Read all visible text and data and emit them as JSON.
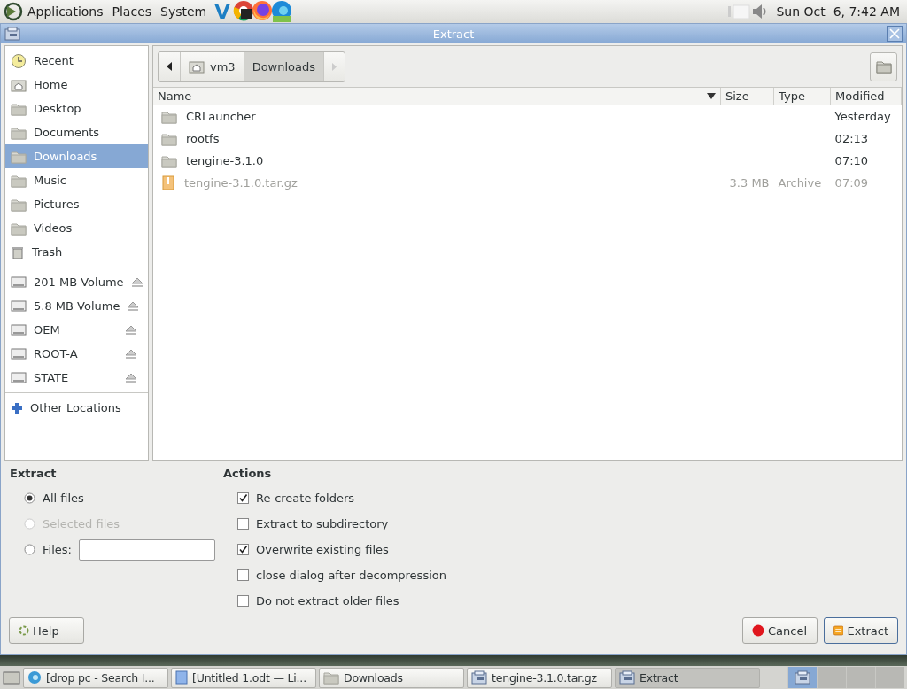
{
  "top_panel": {
    "menus": [
      {
        "label": "Applications"
      },
      {
        "label": "Places"
      },
      {
        "label": "System"
      }
    ],
    "clock": "Sun Oct  6, 7:42 AM"
  },
  "window": {
    "title": "Extract"
  },
  "sidebar": {
    "places": [
      {
        "label": "Recent",
        "kind": "recent",
        "selected": false
      },
      {
        "label": "Home",
        "kind": "home",
        "selected": false
      },
      {
        "label": "Desktop",
        "kind": "folder",
        "selected": false
      },
      {
        "label": "Documents",
        "kind": "folder",
        "selected": false
      },
      {
        "label": "Downloads",
        "kind": "folder",
        "selected": true
      },
      {
        "label": "Music",
        "kind": "folder",
        "selected": false
      },
      {
        "label": "Pictures",
        "kind": "folder",
        "selected": false
      },
      {
        "label": "Videos",
        "kind": "folder",
        "selected": false
      },
      {
        "label": "Trash",
        "kind": "trash",
        "selected": false
      }
    ],
    "volumes": [
      {
        "label": "201 MB Volume"
      },
      {
        "label": "5.8 MB Volume"
      },
      {
        "label": "OEM"
      },
      {
        "label": "ROOT-A"
      },
      {
        "label": "STATE"
      }
    ],
    "other": "Other Locations"
  },
  "path_bar": {
    "segments": [
      {
        "label": "vm3",
        "selected": false
      },
      {
        "label": "Downloads",
        "selected": true
      }
    ]
  },
  "files": {
    "columns": [
      "Name",
      "Size",
      "Type",
      "Modified"
    ],
    "rows": [
      {
        "name": "CRLauncher",
        "kind": "folder",
        "modified": "Yesterday",
        "disabled": false
      },
      {
        "name": "rootfs",
        "kind": "folder",
        "modified": "02:13",
        "disabled": false
      },
      {
        "name": "tengine-3.1.0",
        "kind": "folder",
        "modified": "07:10",
        "disabled": false
      },
      {
        "name": "tengine-3.1.0.tar.gz",
        "kind": "archive",
        "size": "3.3 MB",
        "type": "Archive",
        "modified": "07:09",
        "disabled": true
      }
    ]
  },
  "extract": {
    "title": "Extract",
    "options": [
      {
        "label": "All files",
        "kind": "radio",
        "selected": true,
        "disabled": false
      },
      {
        "label": "Selected files",
        "kind": "radio",
        "selected": false,
        "disabled": true
      },
      {
        "label": "Files:",
        "kind": "field",
        "selected": false,
        "disabled": false
      }
    ]
  },
  "actions": {
    "title": "Actions",
    "options": [
      {
        "label": "Re-create folders",
        "checked": true
      },
      {
        "label": "Extract to subdirectory",
        "checked": false
      },
      {
        "label": "Overwrite existing files",
        "checked": true
      },
      {
        "label": "close dialog after decompression",
        "checked": false
      },
      {
        "label": "Do not extract older files",
        "checked": false
      }
    ]
  },
  "buttons": {
    "help": "Help",
    "cancel": "Cancel",
    "extract": "Extract"
  },
  "taskbar": {
    "tasks": [
      {
        "label": "[drop pc - Search I...",
        "kind": "browser",
        "selected": false
      },
      {
        "label": "[Untitled 1.odt — Li...",
        "kind": "document",
        "selected": false
      },
      {
        "label": "Downloads",
        "kind": "folder",
        "selected": false
      },
      {
        "label": "tengine-3.1.0.tar.gz",
        "kind": "archiver",
        "selected": false
      },
      {
        "label": "Extract",
        "kind": "archiver",
        "selected": true
      }
    ]
  }
}
